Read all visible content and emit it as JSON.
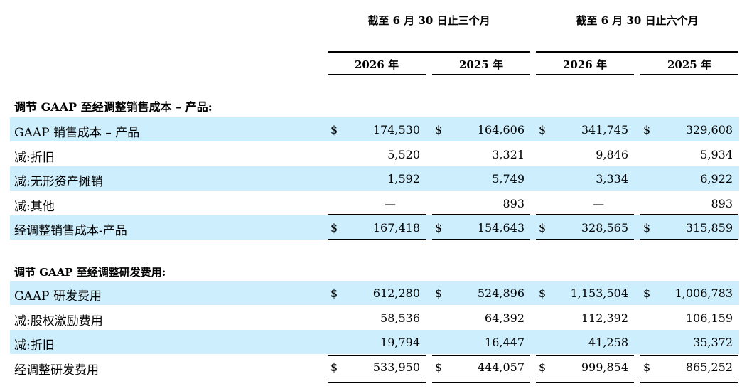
{
  "header": {
    "group_three_months": "截至 6 月 30 日止三个月",
    "group_six_months": "截至 6 月 30 日止六个月",
    "years": [
      "2026 年",
      "2025 年",
      "2026 年",
      "2025 年"
    ]
  },
  "section1": {
    "title": "调节 GAAP 至经调整销售成本 – 产品:",
    "rows": [
      {
        "label": "GAAP 销售成本 – 产品",
        "dollar": true,
        "values": [
          "174,530",
          "164,606",
          "341,745",
          "329,608"
        ]
      },
      {
        "label": "减:折旧",
        "dollar": false,
        "values": [
          "5,520",
          "3,321",
          "9,846",
          "5,934"
        ]
      },
      {
        "label": "减:无形资产摊销",
        "dollar": false,
        "values": [
          "1,592",
          "5,749",
          "3,334",
          "6,922"
        ]
      },
      {
        "label": "减:其他",
        "dollar": false,
        "values": [
          "—",
          "893",
          "—",
          "893"
        ]
      },
      {
        "label": "经调整销售成本-产品",
        "dollar": true,
        "values": [
          "167,418",
          "154,643",
          "328,565",
          "315,859"
        ]
      }
    ]
  },
  "section2": {
    "title": "调节 GAAP 至经调整研发费用:",
    "rows": [
      {
        "label": "GAAP 研发费用",
        "dollar": true,
        "values": [
          "612,280",
          "524,896",
          "1,153,504",
          "1,006,783"
        ]
      },
      {
        "label": "减:股权激励费用",
        "dollar": false,
        "values": [
          "58,536",
          "64,392",
          "112,392",
          "106,159"
        ]
      },
      {
        "label": "减:折旧",
        "dollar": false,
        "values": [
          "19,794",
          "16,447",
          "41,258",
          "35,372"
        ]
      },
      {
        "label": "经调整研发费用",
        "dollar": true,
        "values": [
          "533,950",
          "444,057",
          "999,854",
          "865,252"
        ]
      }
    ]
  },
  "currency_symbol": "$",
  "colors": {
    "shaded_row": "#cdeefd"
  }
}
